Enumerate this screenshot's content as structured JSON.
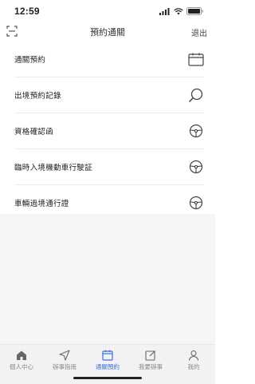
{
  "status_bar": {
    "time": "12:59"
  },
  "header": {
    "title": "預約通關",
    "logout_label": "退出"
  },
  "menu_items": [
    {
      "label": "通關預約",
      "icon": "calendar-icon"
    },
    {
      "label": "出境預約記錄",
      "icon": "search-icon"
    },
    {
      "label": "資格確認函",
      "icon": "steering-wheel-icon"
    },
    {
      "label": "臨時入境機動車行駛証",
      "icon": "steering-wheel-icon"
    },
    {
      "label": "車輛過境通行證",
      "icon": "steering-wheel-icon"
    }
  ],
  "tabs": [
    {
      "label": "個人中心",
      "icon": "home-icon",
      "active": false
    },
    {
      "label": "辦事指南",
      "icon": "navigation-icon",
      "active": false
    },
    {
      "label": "通關預約",
      "icon": "calendar-icon",
      "active": true
    },
    {
      "label": "我要辦事",
      "icon": "edit-icon",
      "active": false
    },
    {
      "label": "我的",
      "icon": "person-icon",
      "active": false
    }
  ],
  "colors": {
    "accent": "#3a6fd8",
    "tab_inactive": "#888888"
  }
}
